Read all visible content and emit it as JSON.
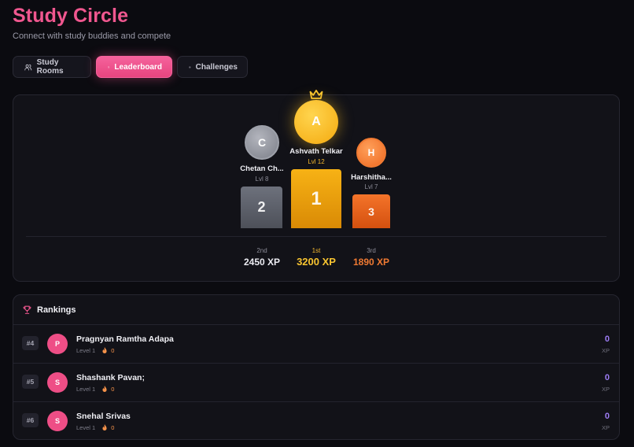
{
  "header": {
    "title": "Study Circle",
    "subtitle": "Connect with study buddies and compete"
  },
  "tabs": [
    {
      "label": "Study Rooms",
      "icon": "users-icon",
      "active": false
    },
    {
      "label": "Leaderboard",
      "icon": "trophy-icon",
      "active": true
    },
    {
      "label": "Challenges",
      "icon": "target-icon",
      "active": false
    }
  ],
  "podium": {
    "first": {
      "initial": "A",
      "name": "Ashvath Telkar",
      "level": "Lvl 12",
      "rank_number": "1",
      "place": "1st",
      "xp": "3200 XP",
      "color": "#f8c430"
    },
    "second": {
      "initial": "C",
      "name": "Chetan Ch...",
      "level": "Lvl 8",
      "rank_number": "2",
      "place": "2nd",
      "xp": "2450 XP",
      "color": "#9ea1aa"
    },
    "third": {
      "initial": "H",
      "name": "Harshitha...",
      "level": "Lvl 7",
      "rank_number": "3",
      "place": "3rd",
      "xp": "1890 XP",
      "color": "#f07a32"
    }
  },
  "rankings": {
    "title": "Rankings",
    "xp_unit": "XP",
    "rows": [
      {
        "position": "#4",
        "initial": "P",
        "name": "Pragnyan Ramtha Adapa",
        "level": "Level 1",
        "streak": "0",
        "xp": "0"
      },
      {
        "position": "#5",
        "initial": "S",
        "name": "Shashank Pavan;",
        "level": "Level 1",
        "streak": "0",
        "xp": "0"
      },
      {
        "position": "#6",
        "initial": "S",
        "name": "Snehal Srivas",
        "level": "Level 1",
        "streak": "0",
        "xp": "0"
      }
    ]
  },
  "colors": {
    "accent": "#f0578f",
    "xp_value": "#9d7cf4",
    "background": "#0b0b10"
  }
}
